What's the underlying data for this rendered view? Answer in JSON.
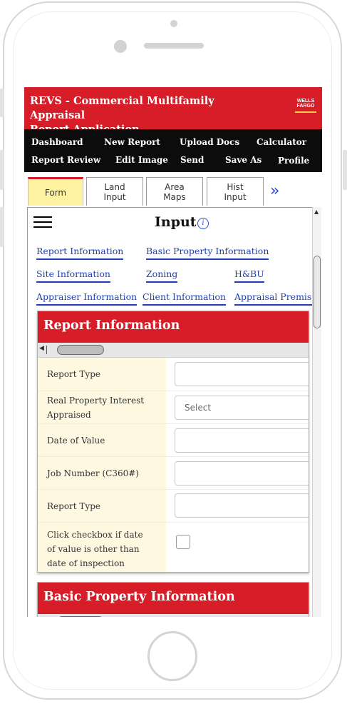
{
  "app": {
    "title_line1": "REVS - Commercial Multifamily Appraisal",
    "title_line2": "Report Application",
    "logo_line1": "WELLS",
    "logo_line2": "FARGO"
  },
  "nav": {
    "row1": [
      "Dashboard",
      "New Report",
      "Upload Docs",
      "Calculator"
    ],
    "row2": [
      "Report Review",
      "Edit Image",
      "Send",
      "Save As",
      "Profile"
    ]
  },
  "tabs": [
    {
      "line1": "Form",
      "line2": ""
    },
    {
      "line1": "Land",
      "line2": "Input"
    },
    {
      "line1": "Area",
      "line2": "Maps"
    },
    {
      "line1": "Hist",
      "line2": "Input"
    }
  ],
  "tab_more_glyph": "»",
  "page": {
    "title": "Input",
    "info_glyph": "i"
  },
  "section_links": [
    "Report Information",
    "Basic Property Information",
    "Site Information",
    "Zoning",
    "H&BU",
    "Appraiser Information",
    "Client Information",
    "Appraisal Premise"
  ],
  "report_info": {
    "heading": "Report Information",
    "rows": [
      {
        "label": "Report Type",
        "value": ""
      },
      {
        "label": "Real Property Interest Appraised",
        "placeholder": "Select"
      },
      {
        "label": "Date of Value",
        "value": ""
      },
      {
        "label": "Job Number (C360#)",
        "value": ""
      },
      {
        "label": "Report Type",
        "value": ""
      },
      {
        "label": "Click checkbox if date of value is other than date of inspection",
        "checked": false
      }
    ]
  },
  "basic_property": {
    "heading": "Basic Property Information"
  },
  "colors": {
    "brand_red": "#d71e28",
    "brand_gold": "#ffcd41",
    "nav_bg": "#0c0c0c",
    "link_blue": "#1c3fb7",
    "label_bg": "#fff8e1",
    "active_tab_bg": "#fff3a3"
  }
}
